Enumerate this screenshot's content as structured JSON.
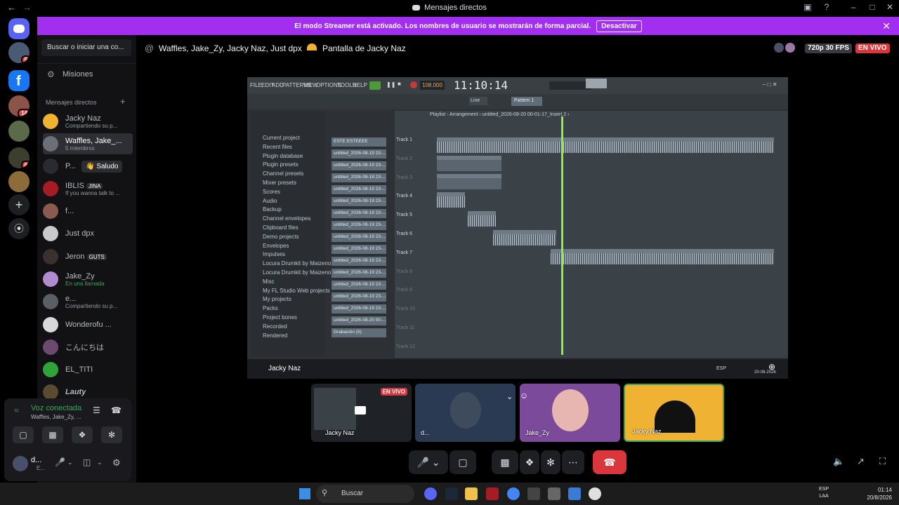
{
  "window": {
    "title": "Mensajes directos"
  },
  "banner": {
    "text": "El modo Streamer está activado. Los nombres de usuario se mostrarán de forma parcial.",
    "action": "Desactivar"
  },
  "servers": [
    {
      "badge": "5"
    },
    {
      "badge": ""
    },
    {
      "badge": "14"
    },
    {
      "badge": ""
    },
    {
      "badge": "6"
    },
    {
      "badge": ""
    }
  ],
  "dms": {
    "search_placeholder": "Buscar o iniciar una co...",
    "nitro": "Misiones",
    "section_title": "Mensajes directos",
    "add": "+",
    "items": [
      {
        "name": "Jacky Naz",
        "sub": "Compartiendo su p..."
      },
      {
        "name": "Waffles, Jake_...",
        "sub": "5 miembros"
      },
      {
        "name": "P...",
        "sub": ""
      },
      {
        "name": "IBLIS",
        "sub": "If you wanna talk to ..."
      },
      {
        "name": "f...",
        "sub": ""
      },
      {
        "name": "Just dpx",
        "sub": ""
      },
      {
        "name": "Jeron",
        "sub": ""
      },
      {
        "name": "Jake_Zy",
        "sub": "En una llamada"
      },
      {
        "name": "e...",
        "sub": "Compartiendo su p..."
      },
      {
        "name": "Wonderofu ...",
        "sub": ""
      },
      {
        "name": "こんにちは",
        "sub": ""
      },
      {
        "name": "EL_TITI",
        "sub": ""
      },
      {
        "name": "Lauty",
        "sub": ""
      }
    ],
    "saludo_tag": "Saludo",
    "jina_tag": "JINA",
    "guts_tag": "GUTS"
  },
  "voice": {
    "status": "Voz conectada",
    "channel": "Waffles, Jake_Zy, ...",
    "user": "d...",
    "user_sub": "E..."
  },
  "header": {
    "participants": "Waffles, Jake_Zy, Jacky Naz, Just dpx",
    "screen": "Pantalla de Jacky Naz",
    "quality": "720p 30 FPS",
    "live": "EN VIVO"
  },
  "fl": {
    "menu": [
      "FILE",
      "EDIT",
      "ADD",
      "PATTERNS",
      "VIEW",
      "OPTIONS",
      "TOOLS",
      "HELP"
    ],
    "bpm": "108.000",
    "time": "11:10:14",
    "pattern": "Pattern 1",
    "line": "Line",
    "playlist_title": "Playlist - Arrangement › untitled_2026-08-20 00-01-17_Insert 2 ›",
    "browser_items": [
      "Current project",
      "Recent files",
      "Plugin database",
      "Plugin presets",
      "Channel presets",
      "Mixer presets",
      "Scores",
      "Audio",
      "Backup",
      "Channel envelopes",
      "Clipboard files",
      "Demo projects",
      "Envelopes",
      "Impulses",
      "Locura Drumkit by Maizeno",
      "Locura Drumkit by Maizeno",
      "Misc",
      "My FL Studio Web projects",
      "My projects",
      "Packs",
      "Project bones",
      "Recorded",
      "Rendered"
    ],
    "patterns": [
      "ESTE ESTEEEE",
      "untitled_2026-08-19 23-...",
      "untitled_2026-08-19 23-...",
      "untitled_2026-08-19 23-...",
      "untitled_2026-08-19 23-...",
      "untitled_2026-08-19 23-...",
      "untitled_2026-08-19 23-...",
      "untitled_2026-08-19 23-...",
      "untitled_2026-08-19 23-...",
      "untitled_2026-08-19 23-...",
      "untitled_2026-08-19 23-...",
      "untitled_2026-08-19 23-...",
      "untitled_2026-08-19 23-...",
      "untitled_2026-08-19 23-...",
      "untitled_2026-08-19 23-...",
      "untitled_2026-08-20 00-...",
      "Grabación (5)"
    ],
    "tracks": [
      "Track 1",
      "Track 2",
      "Track 3",
      "Track 4",
      "Track 5",
      "Track 6",
      "Track 7",
      "Track 8",
      "Track 9",
      "Track 10",
      "Track 11",
      "Track 12"
    ],
    "taskbar_label": "Jacky Naz",
    "esp": "ESP",
    "date": "20-08-2026"
  },
  "tiles": [
    {
      "label": "Jacky Naz",
      "live": "EN VIVO"
    },
    {
      "label": "d..."
    },
    {
      "label": "Jake_Zy"
    },
    {
      "label": "Jacky Naz"
    }
  ],
  "taskbar": {
    "search": "Buscar",
    "lang1": "ESP",
    "lang2": "LAA",
    "time": "01:14",
    "date": "20/8/2026"
  },
  "colors": {
    "banner": "#a22ff0",
    "live": "#da373c",
    "online": "#3ba55d",
    "playhead": "#8df03a"
  }
}
